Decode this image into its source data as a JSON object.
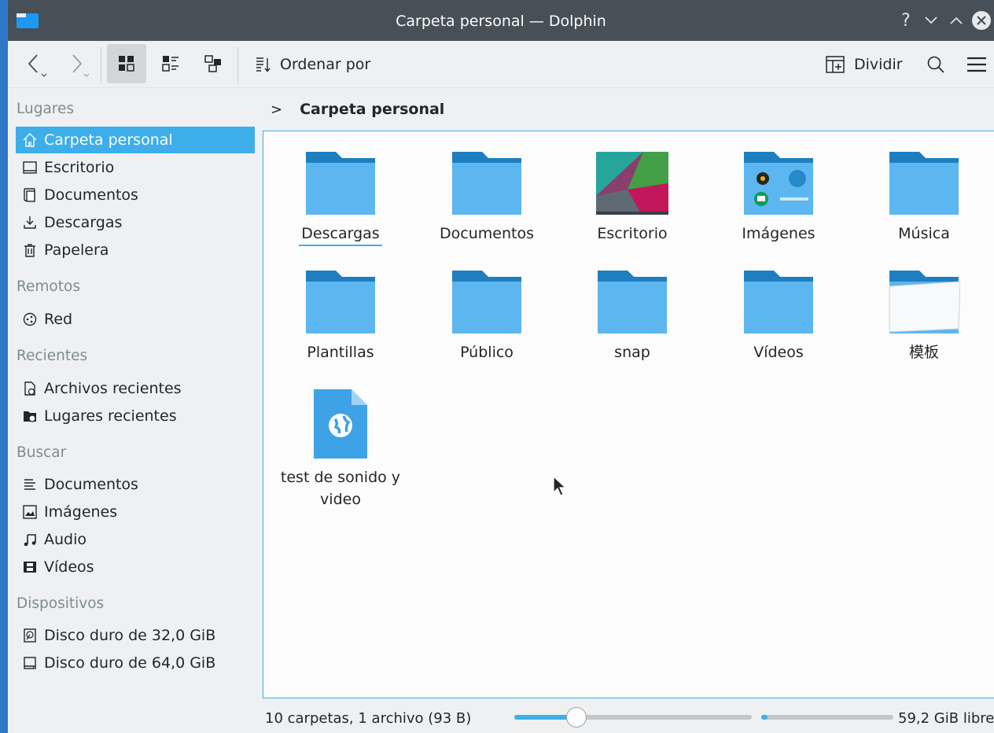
{
  "window": {
    "title": "Carpeta personal — Dolphin",
    "help_glyph": "?",
    "minimize_glyph": "⌄",
    "maximize_glyph": "⌃"
  },
  "toolbar": {
    "sort_label": "Ordenar por",
    "split_label": "Dividir"
  },
  "sidebar": {
    "sections": [
      {
        "title": "Lugares",
        "items": [
          {
            "label": "Carpeta personal",
            "icon": "home-icon",
            "active": true
          },
          {
            "label": "Escritorio",
            "icon": "desktop-icon"
          },
          {
            "label": "Documentos",
            "icon": "documents-icon"
          },
          {
            "label": "Descargas",
            "icon": "downloads-icon"
          },
          {
            "label": "Papelera",
            "icon": "trash-icon"
          }
        ]
      },
      {
        "title": "Remotos",
        "items": [
          {
            "label": "Red",
            "icon": "network-icon"
          }
        ]
      },
      {
        "title": "Recientes",
        "items": [
          {
            "label": "Archivos recientes",
            "icon": "recent-files-icon"
          },
          {
            "label": "Lugares recientes",
            "icon": "recent-places-icon"
          }
        ]
      },
      {
        "title": "Buscar",
        "items": [
          {
            "label": "Documentos",
            "icon": "text-documents-icon"
          },
          {
            "label": "Imágenes",
            "icon": "images-icon"
          },
          {
            "label": "Audio",
            "icon": "audio-icon"
          },
          {
            "label": "Vídeos",
            "icon": "videos-icon"
          }
        ]
      },
      {
        "title": "Dispositivos",
        "items": [
          {
            "label": "Disco duro de 32,0 GiB",
            "icon": "harddisk-icon"
          },
          {
            "label": "Disco duro de 64,0 GiB",
            "icon": "harddisk-icon"
          }
        ]
      }
    ]
  },
  "breadcrumb": {
    "separator": ">",
    "current": "Carpeta personal"
  },
  "files": [
    {
      "name": "Descargas",
      "kind": "folder",
      "focused": true
    },
    {
      "name": "Documentos",
      "kind": "folder"
    },
    {
      "name": "Escritorio",
      "kind": "desktop-preview"
    },
    {
      "name": "Imágenes",
      "kind": "images-preview"
    },
    {
      "name": "Música",
      "kind": "folder"
    },
    {
      "name": "Plantillas",
      "kind": "folder"
    },
    {
      "name": "Público",
      "kind": "folder"
    },
    {
      "name": "snap",
      "kind": "folder"
    },
    {
      "name": "Vídeos",
      "kind": "folder"
    },
    {
      "name": "模板",
      "kind": "templates-preview"
    },
    {
      "name": "test de sonido y video",
      "kind": "html-file"
    }
  ],
  "status": {
    "summary": "10 carpetas, 1 archivo (93 B)",
    "zoom_level": 0.26,
    "disk_used_fraction": 0.04,
    "free_space": "59,2 GiB libre"
  },
  "colors": {
    "accent": "#3daee9",
    "titlebar": "#475057",
    "folder_body": "#5cb6ef",
    "folder_tab": "#1d7fbf"
  }
}
